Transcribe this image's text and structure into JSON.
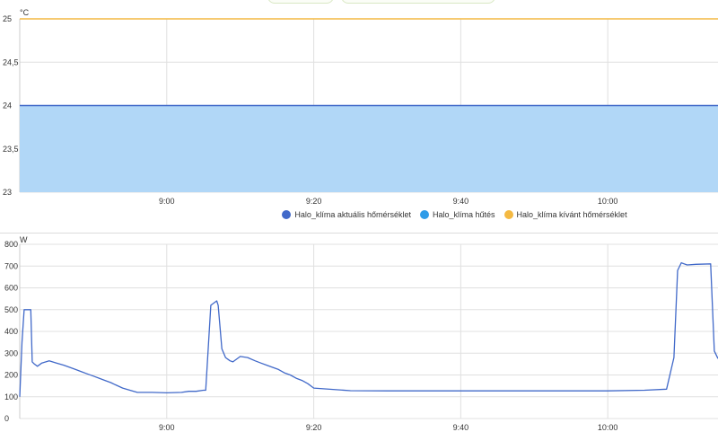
{
  "chart_data": [
    {
      "type": "area",
      "ylabel": "°C",
      "ylim": [
        23,
        25
      ],
      "yticks": [
        "23",
        "23,5",
        "24",
        "24,5",
        "25"
      ],
      "xticks": [
        "9:00",
        "9:20",
        "9:40",
        "10:00"
      ],
      "series": [
        {
          "name": "Halo_klíma aktuális hőmérséklet",
          "color": "#4169c9",
          "fill": "#b1d7f7",
          "x": [
            "8:40",
            "10:15"
          ],
          "values": [
            24,
            24
          ]
        },
        {
          "name": "Halo_klíma hűtés",
          "color": "#2f9ce8",
          "x": [],
          "values": []
        },
        {
          "name": "Halo_klíma kívánt hőmérséklet",
          "color": "#f4b942",
          "x": [
            "8:40",
            "10:15"
          ],
          "values": [
            25,
            25
          ]
        }
      ],
      "grid": true,
      "legend": "bottom"
    },
    {
      "type": "line",
      "ylabel": "W",
      "ylim": [
        0,
        800
      ],
      "yticks": [
        "0",
        "100",
        "200",
        "300",
        "400",
        "500",
        "600",
        "700",
        "800"
      ],
      "xticks": [
        "9:00",
        "9:20",
        "9:40",
        "10:00"
      ],
      "series": [
        {
          "color": "#4169c9",
          "x": [
            "8:40",
            "8:40.3",
            "8:40.6",
            "8:41.5",
            "8:41.7",
            "8:42",
            "8:42.4",
            "8:43",
            "8:44",
            "8:45",
            "8:46",
            "8:46.8",
            "8:47.6",
            "8:48.4",
            "8:49.2",
            "8:50",
            "8:50.8",
            "8:51.6",
            "8:52.4",
            "8:53",
            "8:54",
            "8:55",
            "8:56",
            "8:58",
            "9:00",
            "9:02",
            "9:03",
            "9:04",
            "9:05",
            "9:05.3",
            "9:06",
            "9:06.8",
            "9:07",
            "9:07.5",
            "9:08",
            "9:08.6",
            "9:09",
            "9:10",
            "9:11",
            "9:12",
            "9:12.8",
            "9:13.6",
            "9:14.4",
            "9:15.2",
            "9:16",
            "9:16.8",
            "9:17.6",
            "9:18.4",
            "9:19.2",
            "9:20",
            "9:25",
            "9:30",
            "9:35",
            "9:40",
            "9:45",
            "9:50",
            "9:55",
            "10:00",
            "10:05",
            "10:08",
            "10:09",
            "10:09.5",
            "10:10",
            "10:10.8",
            "10:12",
            "10:14",
            "10:14.5",
            "10:15"
          ],
          "values": [
            100,
            350,
            500,
            500,
            260,
            250,
            240,
            255,
            265,
            255,
            245,
            235,
            225,
            215,
            205,
            195,
            185,
            175,
            165,
            155,
            140,
            130,
            120,
            120,
            118,
            120,
            125,
            125,
            130,
            130,
            520,
            540,
            520,
            320,
            280,
            265,
            260,
            285,
            280,
            265,
            255,
            245,
            235,
            225,
            210,
            200,
            185,
            175,
            160,
            140,
            128,
            127,
            127,
            127,
            127,
            127,
            127,
            127,
            130,
            135,
            280,
            680,
            715,
            705,
            708,
            710,
            310,
            275
          ]
        }
      ],
      "grid": true
    }
  ]
}
